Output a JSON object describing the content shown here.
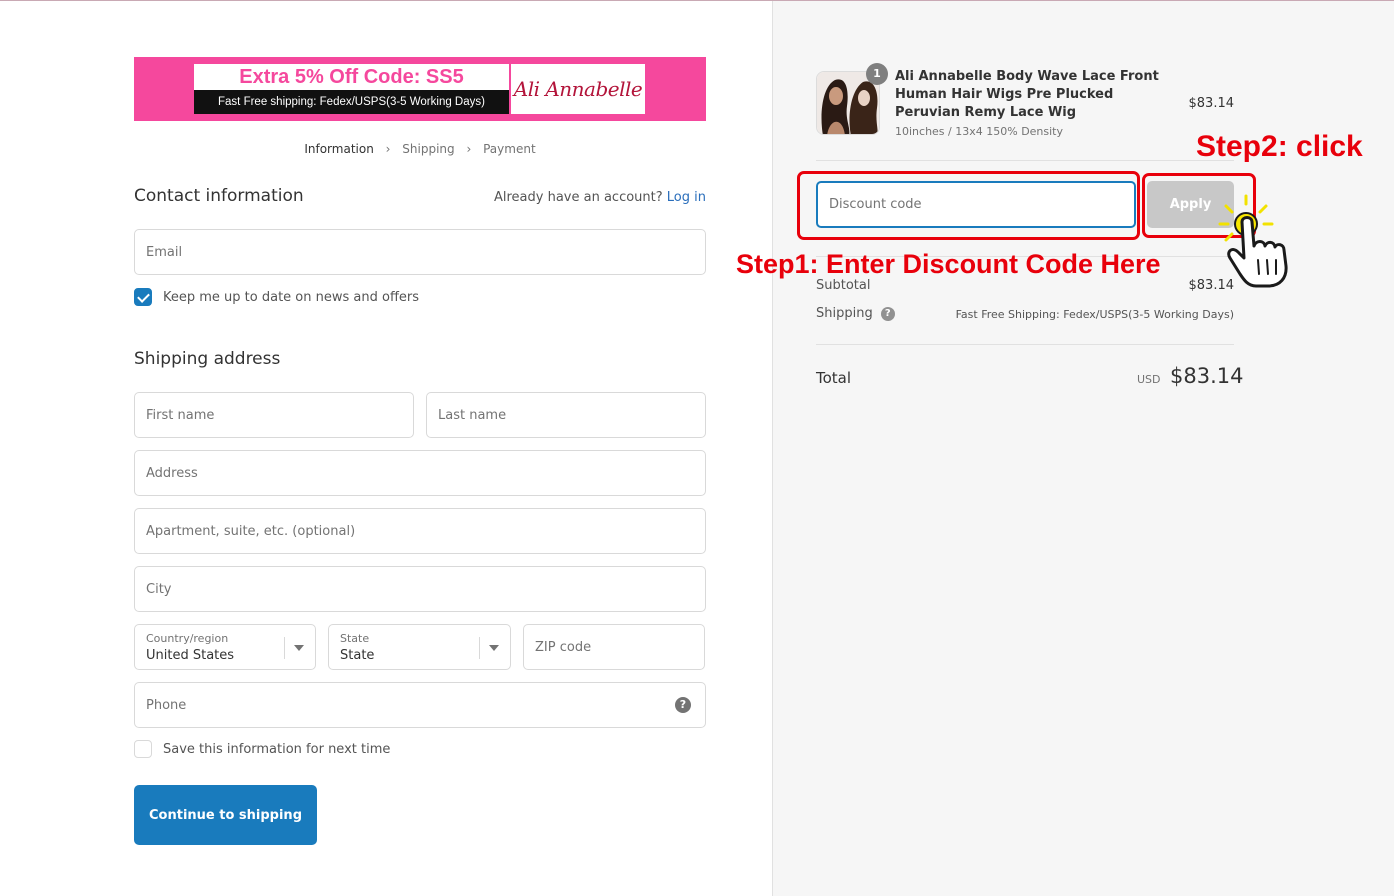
{
  "banner": {
    "headline": "Extra 5% Off Code: SS5",
    "shipping_note": "Fast Free shipping: Fedex/USPS(3-5 Working Days)",
    "logo_text": "Ali Annabelle"
  },
  "breadcrumb": {
    "steps": [
      "Information",
      "Shipping",
      "Payment"
    ]
  },
  "contact": {
    "title": "Contact information",
    "account_prompt": "Already have an account?",
    "login_link": "Log in",
    "email_placeholder": "Email",
    "marketing_label": "Keep me up to date on news and offers",
    "marketing_checked": true
  },
  "shipping_address": {
    "title": "Shipping address",
    "first_name_placeholder": "First name",
    "last_name_placeholder": "Last name",
    "address_placeholder": "Address",
    "apartment_placeholder": "Apartment, suite, etc. (optional)",
    "city_placeholder": "City",
    "country_label": "Country/region",
    "country_value": "United States",
    "state_label": "State",
    "state_value": "State",
    "zip_placeholder": "ZIP code",
    "phone_placeholder": "Phone",
    "save_info_label": "Save this information for next time",
    "save_info_checked": false
  },
  "continue_button": "Continue to shipping",
  "order_summary": {
    "quantity": "1",
    "product_name": "Ali Annabelle Body Wave Lace Front Human Hair Wigs Pre Plucked Peruvian Remy Lace Wig",
    "product_variant": "10inches / 13x4 150% Density",
    "product_price": "$83.14",
    "discount_placeholder": "Discount code",
    "apply_label": "Apply",
    "subtotal_label": "Subtotal",
    "subtotal_value": "$83.14",
    "shipping_label": "Shipping",
    "shipping_value": "Fast Free Shipping: Fedex/USPS(3-5 Working Days)",
    "total_label": "Total",
    "total_currency": "USD",
    "total_value": "$83.14"
  },
  "annotations": {
    "step1": "Step1: Enter Discount Code Here",
    "step2": "Step2: click"
  },
  "colors": {
    "accent": "#197bbd",
    "annotation_red": "#e8000b",
    "banner_pink": "#f5489d"
  }
}
